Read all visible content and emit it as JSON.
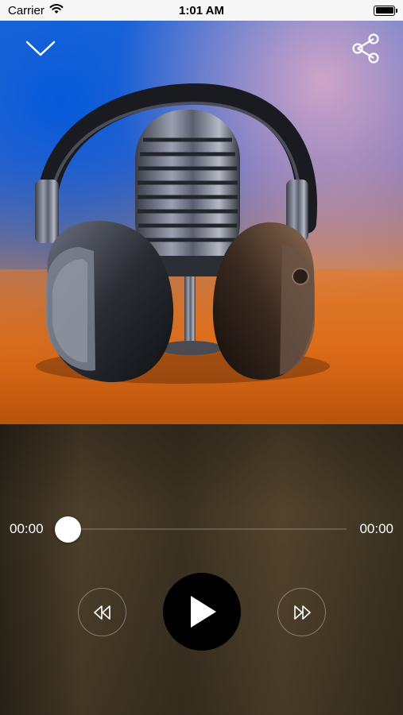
{
  "status_bar": {
    "carrier": "Carrier",
    "time": "1:01 AM",
    "icons": [
      "wifi-icon",
      "battery-icon"
    ]
  },
  "header": {
    "collapse_icon": "chevron-down-icon",
    "share_icon": "share-icon"
  },
  "artwork": {
    "subject": "studio microphone inside headphones"
  },
  "player": {
    "current_time": "00:00",
    "total_time": "00:00",
    "progress": 0,
    "controls": {
      "rewind_icon": "rewind-icon",
      "play_icon": "play-icon",
      "forward_icon": "fast-forward-icon"
    }
  },
  "colors": {
    "accent": "#ffffff",
    "play_button": "#000000",
    "panel_background": "#3f3425"
  }
}
